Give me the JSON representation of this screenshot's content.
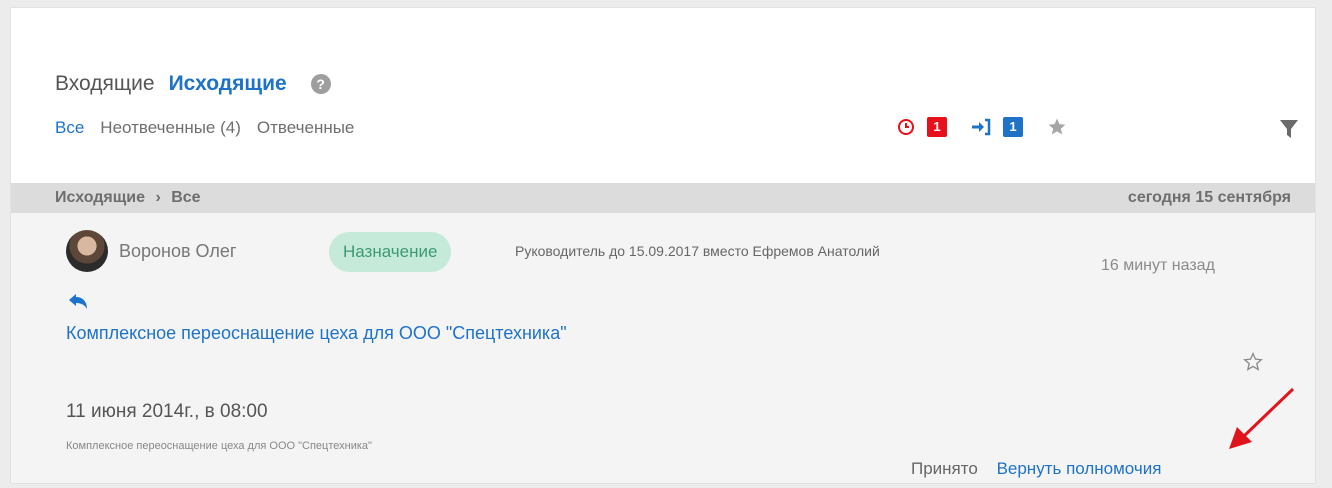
{
  "header": {
    "tab_incoming": "Входящие",
    "tab_outgoing": "Исходящие",
    "help": "?"
  },
  "filters": {
    "all": "Все",
    "unanswered": "Неотвеченные (4)",
    "answered": "Отвеченные"
  },
  "indicators": {
    "overdue_count": "1",
    "delegated_count": "1",
    "colors": {
      "red": "#e8101a",
      "blue": "#1e73c9"
    }
  },
  "breadcrumb": {
    "section": "Исходящие",
    "separator": "›",
    "current": "Все",
    "date": "сегодня 15 сентября"
  },
  "message": {
    "author": "Воронов Олег",
    "tag": "Назначение",
    "description": "Руководитель до 15.09.2017 вместо Ефремов Анатолий",
    "time_ago": "16 минут назад",
    "subject": "Комплексное переоснащение цеха для ООО \"Спецтехника\"",
    "date": "11 июня 2014г., в 08:00",
    "note": "Комплексное переоснащение цеха для ООО \"Спецтехника\"",
    "action_accepted": "Принято",
    "action_revoke": "Вернуть полномочия"
  }
}
